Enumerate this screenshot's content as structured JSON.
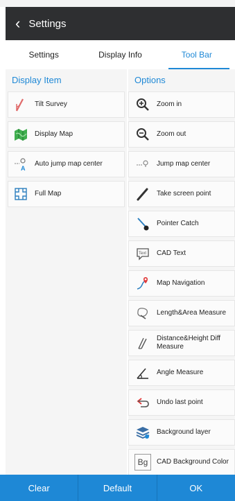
{
  "header": {
    "title": "Settings"
  },
  "tabs": [
    {
      "label": "Settings"
    },
    {
      "label": "Display Info"
    },
    {
      "label": "Tool Bar",
      "active": true
    }
  ],
  "left": {
    "heading": "Display Item",
    "items": [
      {
        "label": "Tilt Survey",
        "icon": "tilt-survey-icon"
      },
      {
        "label": "Display Map",
        "icon": "map-icon"
      },
      {
        "label": "Auto jump map center",
        "icon": "auto-jump-icon"
      },
      {
        "label": "Full Map",
        "icon": "full-map-icon"
      }
    ]
  },
  "right": {
    "heading": "Options",
    "items": [
      {
        "label": "Zoom in",
        "icon": "zoom-in-icon"
      },
      {
        "label": "Zoom out",
        "icon": "zoom-out-icon"
      },
      {
        "label": "Jump map center",
        "icon": "jump-center-icon"
      },
      {
        "label": "Take screen point",
        "icon": "pen-icon"
      },
      {
        "label": "Pointer Catch",
        "icon": "pointer-catch-icon"
      },
      {
        "label": "CAD Text",
        "icon": "cad-text-icon"
      },
      {
        "label": "Map Navigation",
        "icon": "navigation-icon"
      },
      {
        "label": "Length&Area Measure",
        "icon": "length-area-icon"
      },
      {
        "label": "Distance&Height Diff Measure",
        "icon": "distance-height-icon"
      },
      {
        "label": "Angle Measure",
        "icon": "angle-icon"
      },
      {
        "label": "Undo last point",
        "icon": "undo-icon"
      },
      {
        "label": "Background layer",
        "icon": "layers-icon"
      },
      {
        "label": "CAD Background Color",
        "icon": "bg-color-icon",
        "icon_text": "Bg"
      }
    ]
  },
  "footer": {
    "clear": "Clear",
    "default": "Default",
    "ok": "OK"
  },
  "colors": {
    "accent": "#1e88d6",
    "header": "#2e2f31"
  }
}
